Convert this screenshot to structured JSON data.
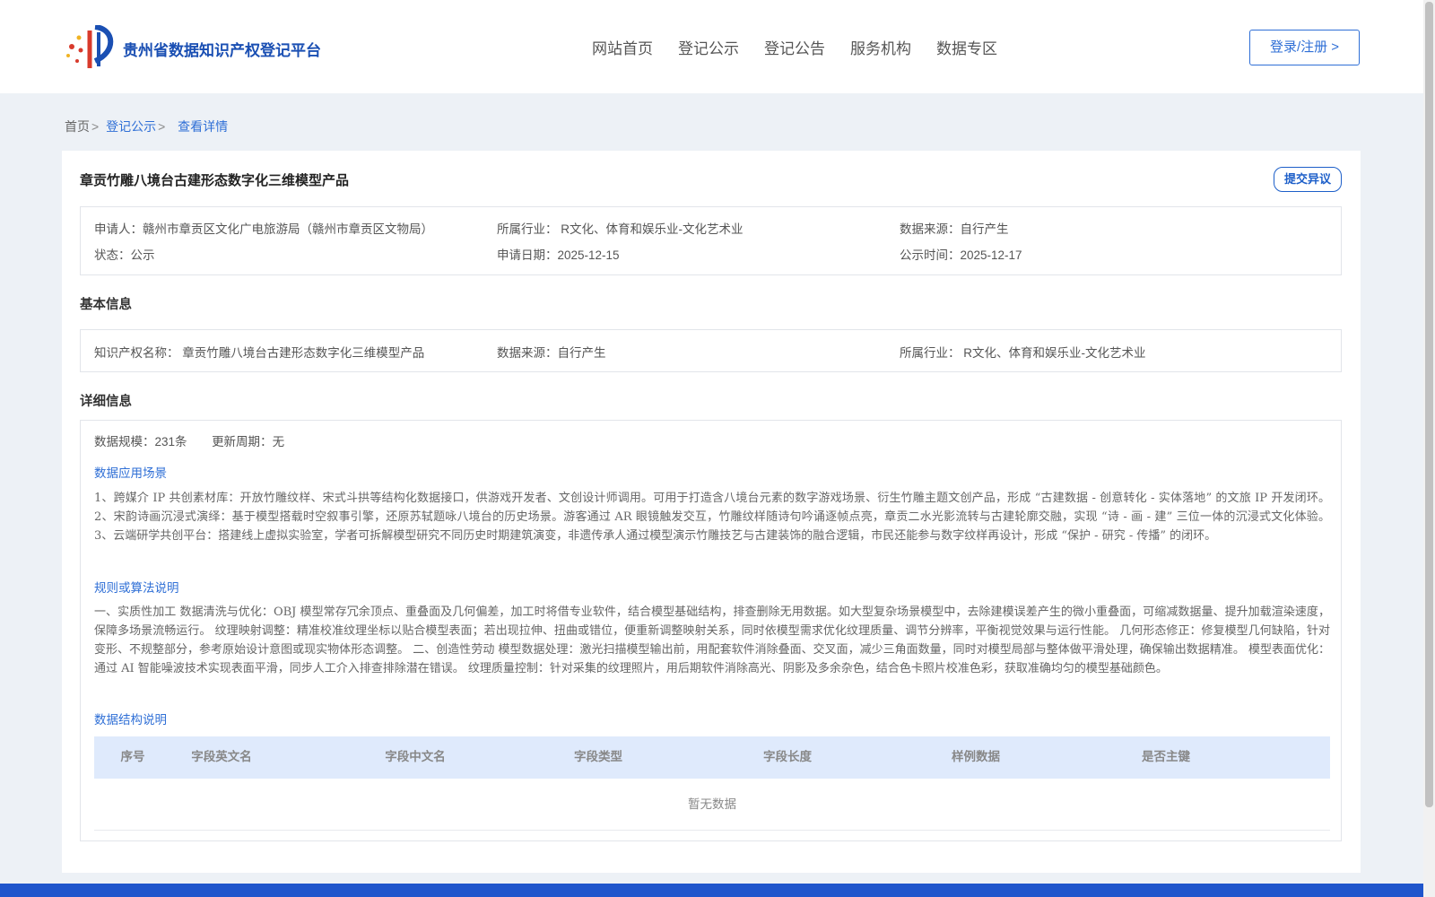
{
  "header": {
    "brand": "贵州省数据知识产权登记平台",
    "nav": [
      "网站首页",
      "登记公示",
      "登记公告",
      "服务机构",
      "数据专区"
    ],
    "login_label": "登录/注册 >"
  },
  "breadcrumb": {
    "home": "首页",
    "sep": ">",
    "publicity": "登记公示",
    "current": "查看详情"
  },
  "detail": {
    "title": "章贡竹雕八境台古建形态数字化三维模型产品",
    "objection_label": "提交异议",
    "summary": {
      "applicant_label": "申请人：",
      "applicant": "赣州市章贡区文化广电旅游局（赣州市章贡区文物局）",
      "industry_label": "所属行业：",
      "industry": "R文化、体育和娱乐业-文化艺术业",
      "source_label": "数据来源：",
      "source": "自行产生",
      "status_label": "状态：",
      "status": "公示",
      "apply_date_label": "申请日期：",
      "apply_date": "2025-12-15",
      "publish_time_label": "公示时间：",
      "publish_time": "2025-12-17"
    },
    "basic": {
      "section_title": "基本信息",
      "ip_name_label": "知识产权名称：",
      "ip_name": "章贡竹雕八境台古建形态数字化三维模型产品",
      "source_label": "数据来源：",
      "source": "自行产生",
      "industry_label": "所属行业：",
      "industry": "R文化、体育和娱乐业-文化艺术业"
    },
    "details": {
      "section_title": "详细信息",
      "scale_label": "数据规模：",
      "scale": "231条",
      "cycle_label": "更新周期：",
      "cycle": "无",
      "scenario_title": "数据应用场景",
      "scenario_text": "1、跨媒介 IP 共创素材库：开放竹雕纹样、宋式斗拱等结构化数据接口，供游戏开发者、文创设计师调用。可用于打造含八境台元素的数字游戏场景、衍生竹雕主题文创产品，形成 “古建数据 - 创意转化 - 实体落地” 的文旅 IP 开发闭环。 2、宋韵诗画沉浸式演绎：基于模型搭载时空叙事引擎，还原苏轼题咏八境台的历史场景。游客通过 AR 眼镜触发交互，竹雕纹样随诗句吟诵逐帧点亮，章贡二水光影流转与古建轮廓交融，实现 “诗 - 画 - 建” 三位一体的沉浸式文化体验。 3、云端研学共创平台：搭建线上虚拟实验室，学者可拆解模型研究不同历史时期建筑演变，非遗传承人通过模型演示竹雕技艺与古建装饰的融合逻辑，市民还能参与数字纹样再设计，形成 “保护 - 研究 - 传播” 的闭环。",
      "rules_title": "规则或算法说明",
      "rules_text": "一、实质性加工 数据清洗与优化：OBJ 模型常存冗余顶点、重叠面及几何偏差，加工时将借专业软件，结合模型基础结构，排查删除无用数据。如大型复杂场景模型中，去除建模误差产生的微小重叠面，可缩减数据量、提升加载渲染速度，保障多场景流畅运行。 纹理映射调整：精准校准纹理坐标以贴合模型表面；若出现拉伸、扭曲或错位，便重新调整映射关系，同时依模型需求优化纹理质量、调节分辨率，平衡视觉效果与运行性能。 几何形态修正：修复模型几何缺陷，针对变形、不规整部分，参考原始设计意图或现实物体形态调整。 二、创造性劳动 模型数据处理：激光扫描模型输出前，用配套软件消除叠面、交叉面，减少三角面数量，同时对模型局部与整体做平滑处理，确保输出数据精准。 模型表面优化：通过 AI 智能噪波技术实现表面平滑，同步人工介入排查排除潜在错误。 纹理质量控制：针对采集的纹理照片，用后期软件消除高光、阴影及多余杂色，结合色卡照片校准色彩，获取准确均匀的模型基础颜色。",
      "structure_title": "数据结构说明",
      "table_columns": [
        "序号",
        "字段英文名",
        "字段中文名",
        "字段类型",
        "字段长度",
        "样例数据",
        "是否主键"
      ],
      "empty_text": "暂无数据"
    }
  },
  "colors": {
    "accent": "#2f6fd6",
    "brand": "#1a4fb3",
    "page_bg": "#edf1f6",
    "table_head_bg": "#dfeafc",
    "footer": "#1f55cc"
  }
}
